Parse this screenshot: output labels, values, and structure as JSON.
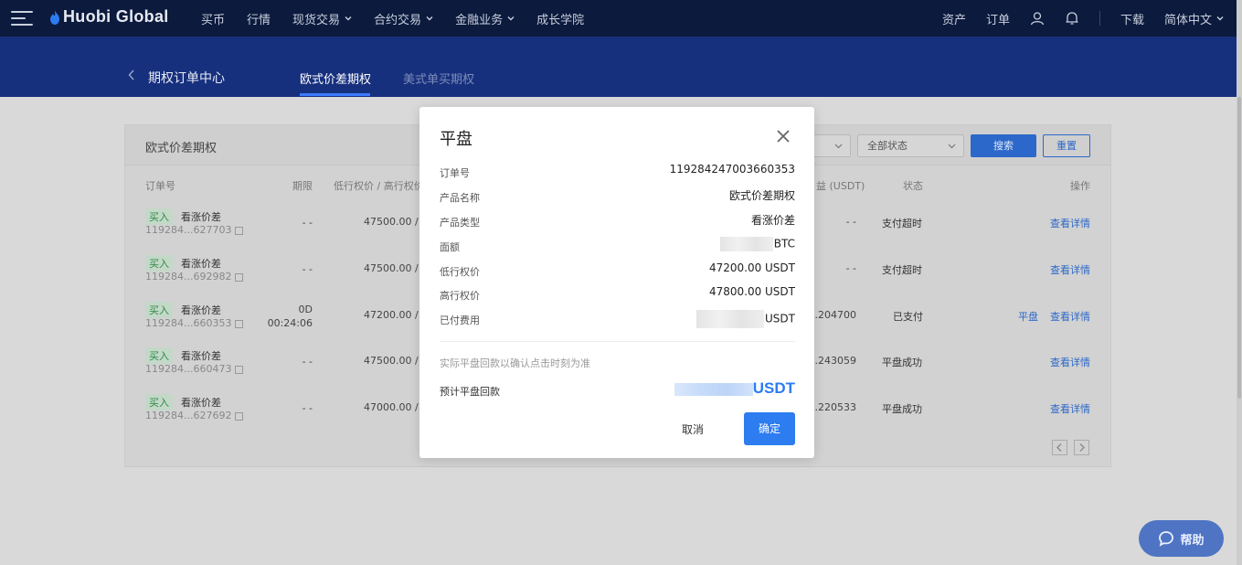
{
  "nav": {
    "logo": "Huobi Global",
    "items": [
      "买币",
      "行情",
      "现货交易",
      "合约交易",
      "金融业务",
      "成长学院"
    ],
    "right": {
      "assets": "资产",
      "orders": "订单",
      "download": "下载",
      "language": "简体中文"
    }
  },
  "subheader": {
    "title": "期权订单中心",
    "tabs": [
      "欧式价差期权",
      "美式单买期权"
    ],
    "active_tab": 0
  },
  "panel": {
    "title": "欧式价差期权",
    "status_select": "全部状态",
    "search_label": "搜索",
    "reset_label": "重置",
    "columns": {
      "order_no": "订单号",
      "term": "期限",
      "strikes": "低行权价 / 高行权价",
      "profit": "益 (USDT)",
      "status": "状态",
      "action": "操作"
    },
    "rows": [
      {
        "side": "买入",
        "type": "看涨价差",
        "id": "119284...627703",
        "term": "- -",
        "term2": "",
        "strike": "47500.00 / 4",
        "profit": "- -",
        "status": "支付超时",
        "action": "查看详情",
        "action2": ""
      },
      {
        "side": "买入",
        "type": "看涨价差",
        "id": "119284...692982",
        "term": "- -",
        "term2": "",
        "strike": "47500.00 / 4",
        "profit": "- -",
        "status": "支付超时",
        "action": "查看详情",
        "action2": ""
      },
      {
        "side": "买入",
        "type": "看涨价差",
        "id": "119284...660353",
        "term": "0D",
        "term2": "00:24:06",
        "strike": "47200.00 / 4",
        "profit": "0.204700",
        "status": "已支付",
        "action": "查看详情",
        "action2": "平盘"
      },
      {
        "side": "买入",
        "type": "看涨价差",
        "id": "119284...660473",
        "term": "- -",
        "term2": "",
        "strike": "47500.00 / 4",
        "profit": "1.243059",
        "status": "平盘成功",
        "action": "查看详情",
        "action2": ""
      },
      {
        "side": "买入",
        "type": "看涨价差",
        "id": "119284...627692",
        "term": "- -",
        "term2": "",
        "strike": "47000.00 / 4",
        "profit": "2.220533",
        "status": "平盘成功",
        "action": "查看详情",
        "action2": ""
      }
    ]
  },
  "modal": {
    "title": "平盘",
    "fields": [
      {
        "label": "订单号",
        "value": "119284247003660353"
      },
      {
        "label": "产品名称",
        "value": "欧式价差期权"
      },
      {
        "label": "产品类型",
        "value": "看涨价差"
      },
      {
        "label": "面额",
        "value": "BTC",
        "blurred": true
      },
      {
        "label": "低行权价",
        "value": "47200.00 USDT"
      },
      {
        "label": "高行权价",
        "value": "47800.00 USDT"
      },
      {
        "label": "已付费用",
        "value": "USDT",
        "blurred": true
      }
    ],
    "note": "实际平盘回款以确认点击时刻为准",
    "estimate_label": "预计平盘回款",
    "estimate_unit": "USDT",
    "cancel_label": "取消",
    "confirm_label": "确定"
  },
  "help_label": "帮助",
  "colors": {
    "nav_bg": "#0b1a3d",
    "band_bg": "#17307e",
    "accent": "#2d7cf0",
    "buy_green": "#2a8b44"
  }
}
